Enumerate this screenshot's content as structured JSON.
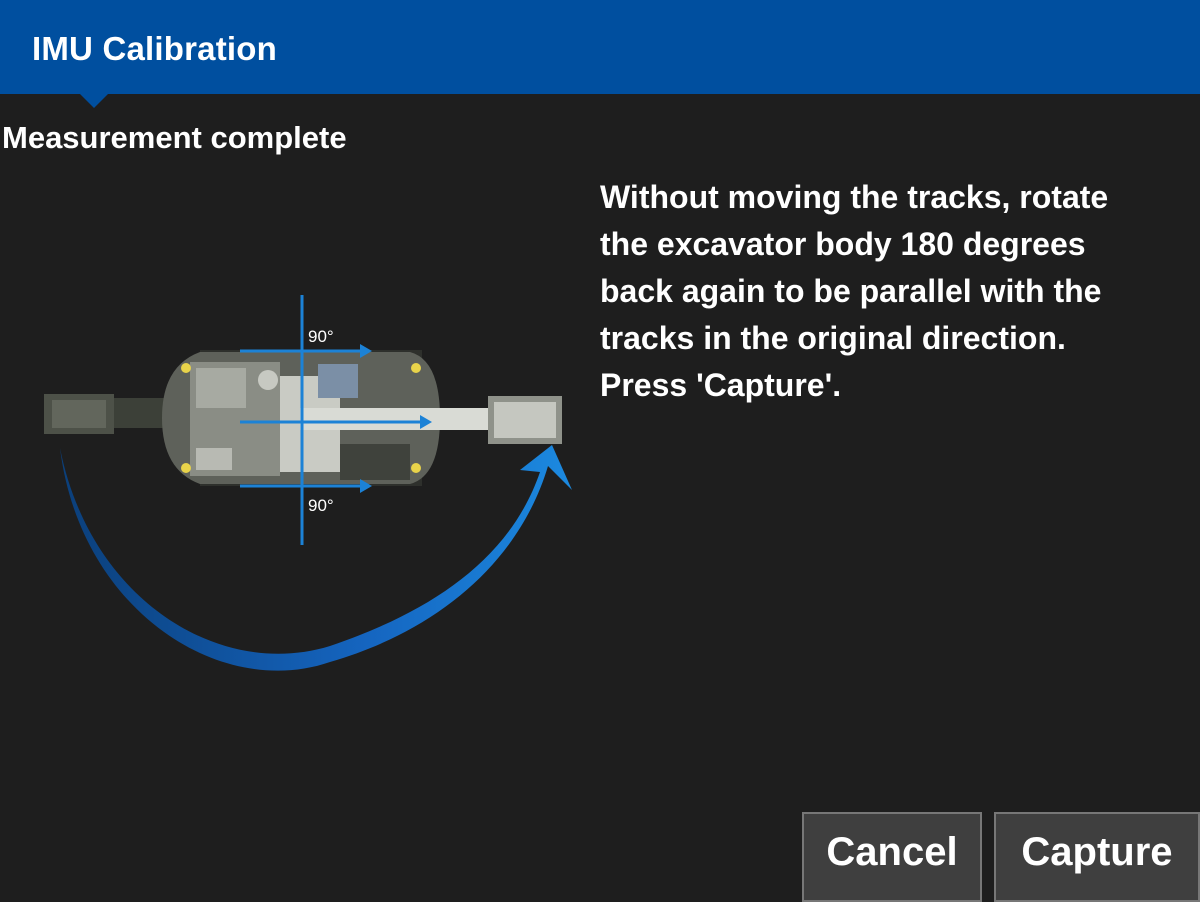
{
  "header": {
    "title": "IMU Calibration",
    "color": "#004f9f"
  },
  "status": "Measurement complete",
  "instructions": "Without moving the tracks, rotate\nthe excavator body 180 degrees\nback again to be parallel with the\ntracks in the original direction.\nPress 'Capture'.",
  "illustration": {
    "angle_top": "90°",
    "angle_bottom": "90°",
    "icons": [
      "excavator-top-view",
      "rotation-arrow-icon",
      "direction-arrow-icon"
    ],
    "accent": "#1c82d6"
  },
  "buttons": {
    "cancel": "Cancel",
    "capture": "Capture"
  }
}
